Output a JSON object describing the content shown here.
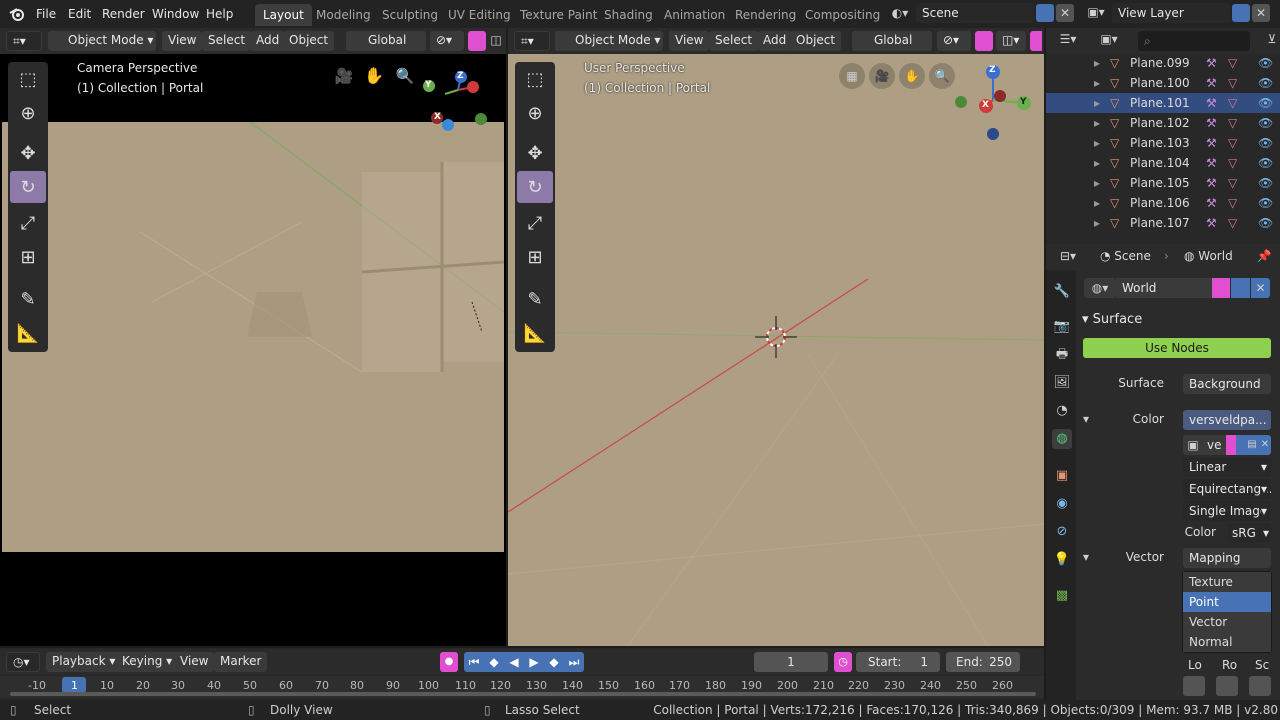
{
  "top_menu": [
    "File",
    "Edit",
    "Render",
    "Window",
    "Help"
  ],
  "workspaces": [
    "Layout",
    "Modeling",
    "Sculpting",
    "UV Editing",
    "Texture Paint",
    "Shading",
    "Animation",
    "Rendering",
    "Compositing"
  ],
  "scene_name": "Scene",
  "view_layer": "View Layer",
  "left_vp": {
    "mode": "Object Mode",
    "menus": [
      "View",
      "Select",
      "Add",
      "Object"
    ],
    "orientation": "Global",
    "overlay_title": "Camera Perspective",
    "overlay_sub": "(1) Collection | Portal"
  },
  "right_vp": {
    "mode": "Object Mode",
    "menus": [
      "View",
      "Select",
      "Add",
      "Object"
    ],
    "orientation": "Global",
    "overlay_title": "User Perspective",
    "overlay_sub": "(1) Collection | Portal"
  },
  "gizmo_axes": {
    "x": "X",
    "y": "Y",
    "z": "Z"
  },
  "outliner": {
    "items": [
      "Plane.099",
      "Plane.100",
      "Plane.101",
      "Plane.102",
      "Plane.103",
      "Plane.104",
      "Plane.105",
      "Plane.106",
      "Plane.107"
    ],
    "selected_index": 2
  },
  "properties": {
    "crumb_scene": "Scene",
    "crumb_world": "World",
    "world_name": "World",
    "panel_surface": "Surface",
    "use_nodes": "Use Nodes",
    "surface_label": "Surface",
    "surface_value": "Background",
    "color_label": "Color",
    "color_value": "versveldpa...",
    "image_name": "ve",
    "interpolation": "Linear",
    "projection": "Equirectang...",
    "source": "Single Image",
    "colorspace_label": "Color",
    "colorspace_value": "sRG",
    "vector_label": "Vector",
    "vector_value": "Mapping",
    "vector_options": [
      "Texture",
      "Point",
      "Vector",
      "Normal"
    ],
    "vector_selected": 1,
    "loc_cols": [
      "Lo",
      "Ro",
      "Sc"
    ]
  },
  "timeline": {
    "menus": [
      "Playback",
      "Keying",
      "View",
      "Marker"
    ],
    "current_frame": "1",
    "start_label": "Start:",
    "start_value": "1",
    "end_label": "End:",
    "end_value": "250",
    "ticks": [
      "-10",
      "1",
      "10",
      "20",
      "30",
      "40",
      "50",
      "60",
      "70",
      "80",
      "90",
      "100",
      "110",
      "120",
      "130",
      "140",
      "150",
      "160",
      "170",
      "180",
      "190",
      "200",
      "210",
      "220",
      "230",
      "240",
      "250",
      "260"
    ]
  },
  "status": {
    "select": "Select",
    "dolly": "Dolly View",
    "lasso": "Lasso Select",
    "stats": "Collection | Portal | Verts:172,216 | Faces:170,126 | Tris:340,869 | Objects:0/309 | Mem: 93.7 MB | v2.80"
  },
  "colors": {
    "accent": "#4772b3",
    "active_tool": "#8d7aa8",
    "use_nodes": "#8fd14f",
    "viewport": "#ae9e84",
    "axis_x": "#d03a3a",
    "axis_y": "#6ab04c",
    "axis_z": "#3a6fd0"
  }
}
